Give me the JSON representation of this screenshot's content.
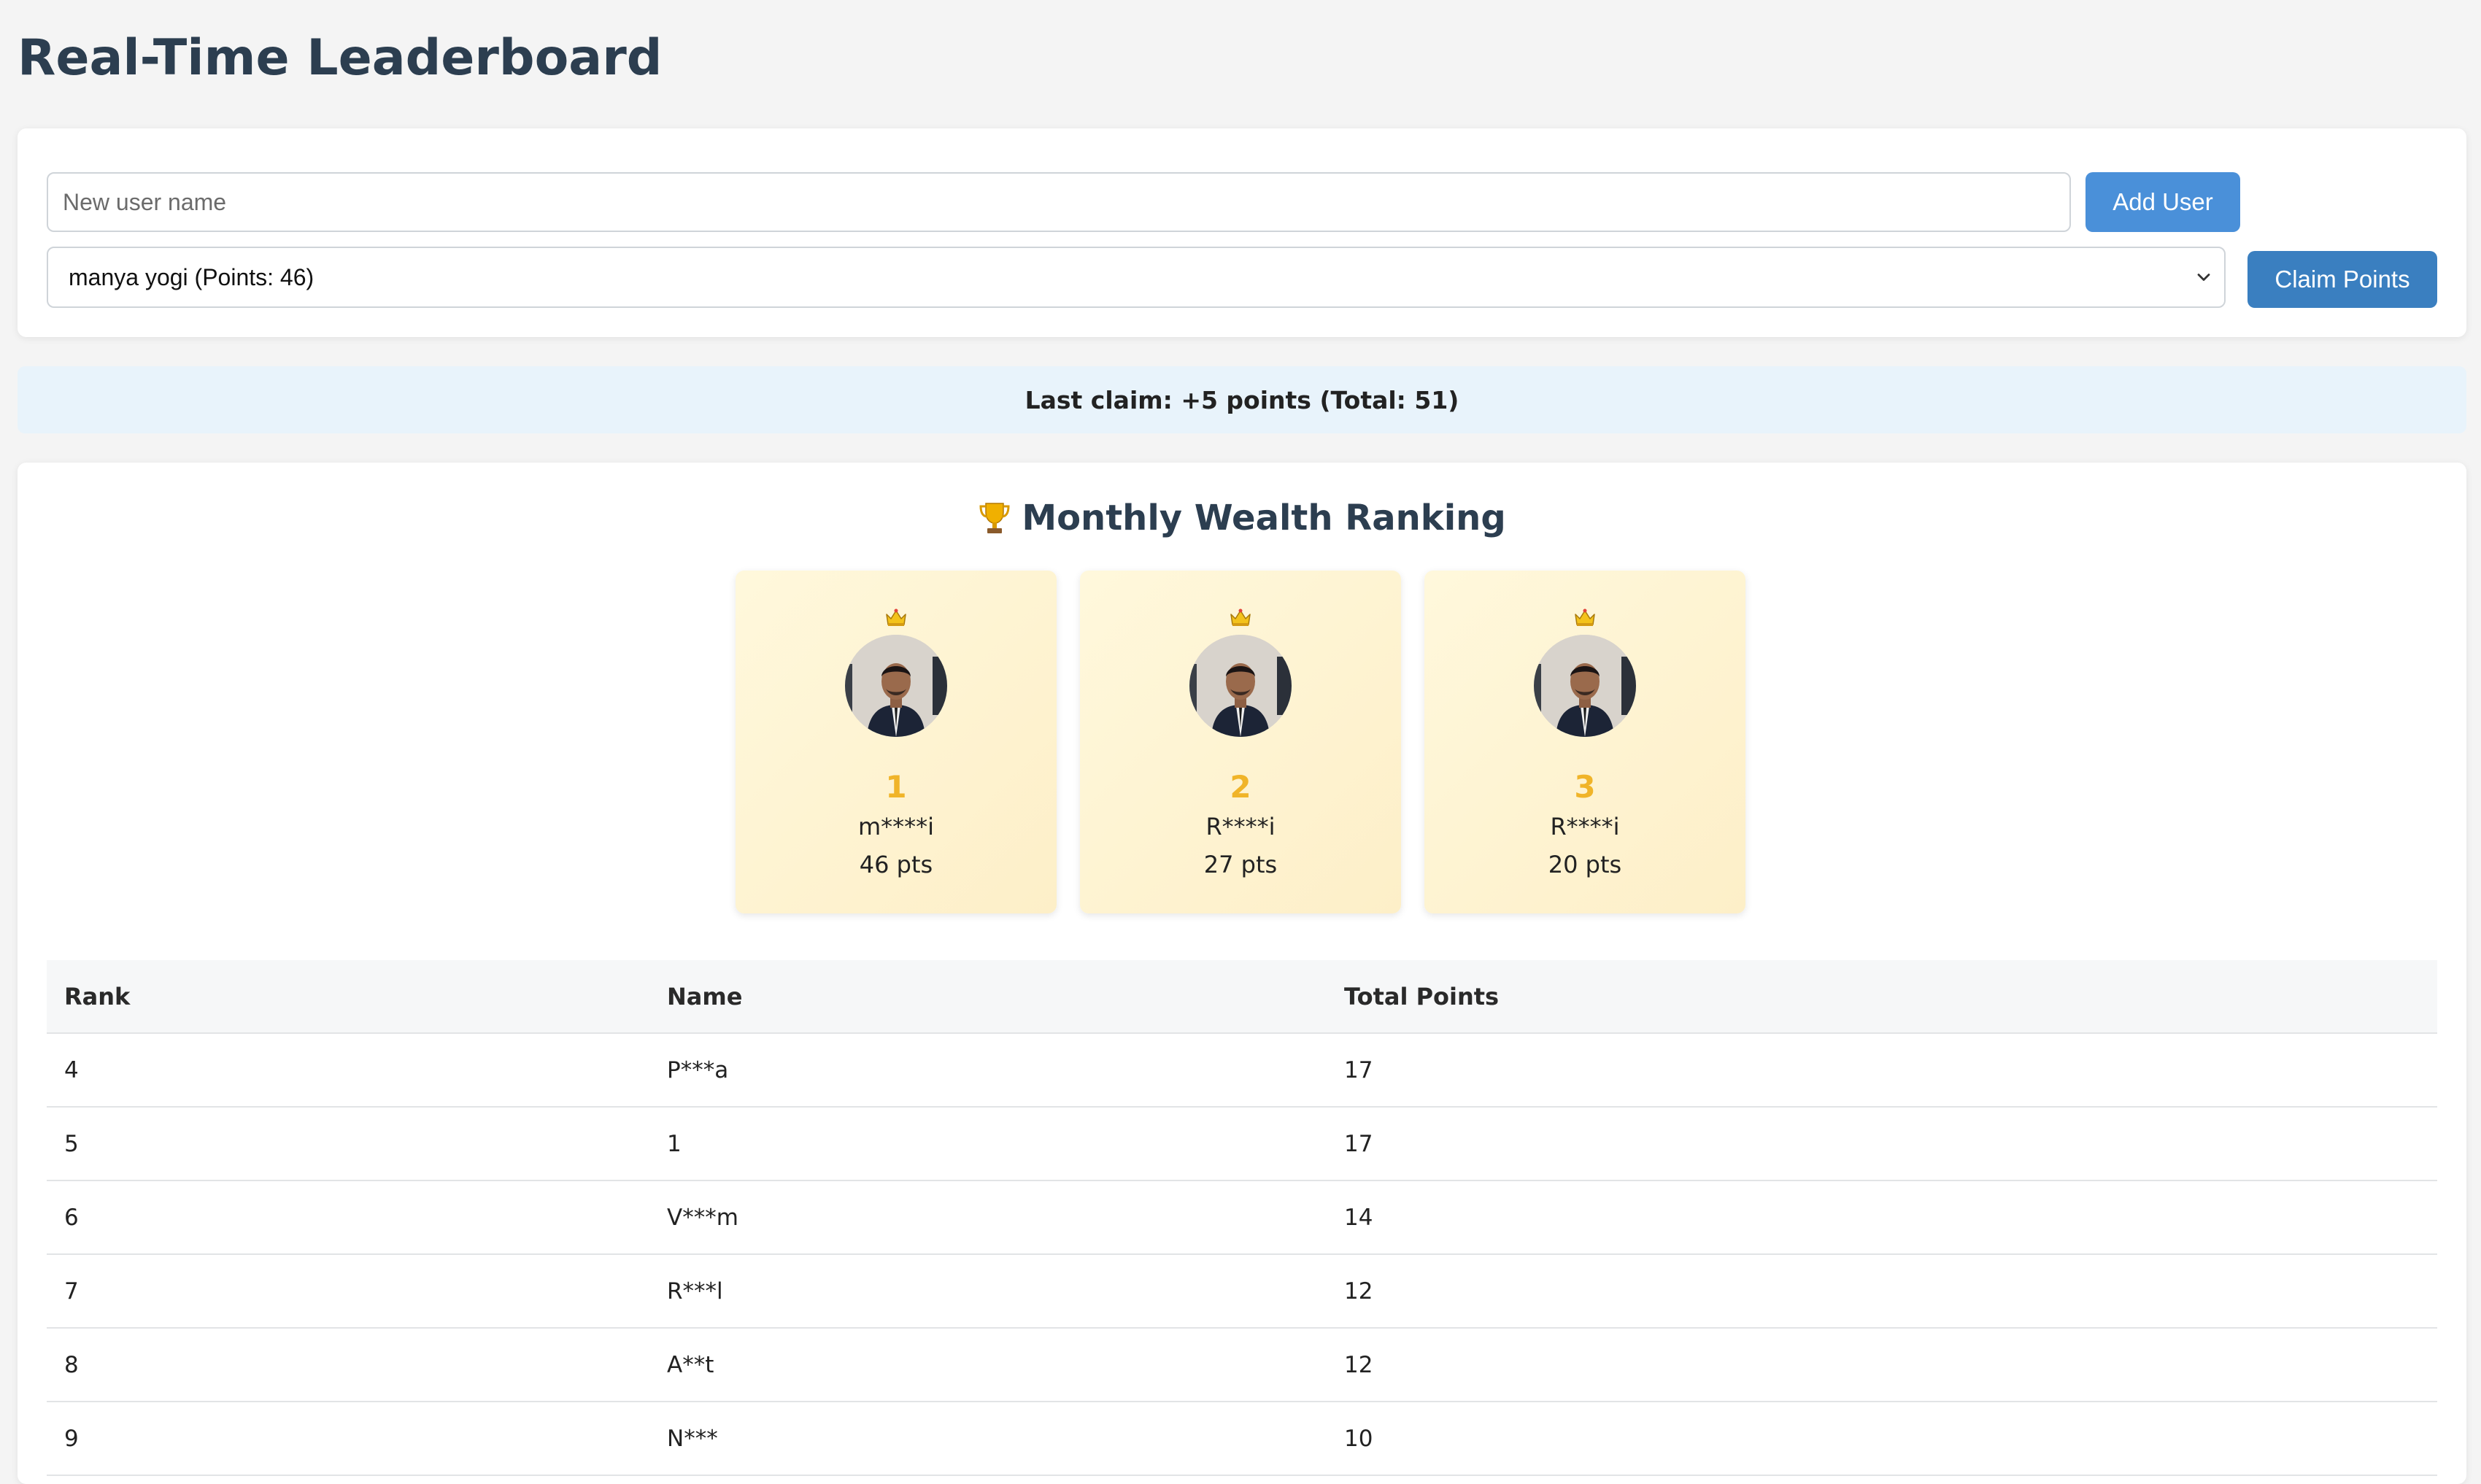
{
  "app": {
    "title": "Real-Time Leaderboard"
  },
  "controls": {
    "new_user_placeholder": "New user name",
    "add_user_label": "Add User",
    "selected_user": "manya yogi (Points: 46)",
    "claim_label": "Claim Points"
  },
  "status": {
    "text": "Last claim: +5 points (Total: 51)"
  },
  "ranking": {
    "title": "Monthly Wealth Ranking",
    "title_icon": "trophy-icon",
    "podium": [
      {
        "rank": "1",
        "name": "m****i",
        "points": "46 pts",
        "icon": "crown-icon"
      },
      {
        "rank": "2",
        "name": "R****i",
        "points": "27 pts",
        "icon": "crown-icon"
      },
      {
        "rank": "3",
        "name": "R****i",
        "points": "20 pts",
        "icon": "crown-icon"
      }
    ],
    "table": {
      "headers": [
        "Rank",
        "Name",
        "Total Points"
      ],
      "rows": [
        {
          "rank": "4",
          "name": "P***a",
          "points": "17"
        },
        {
          "rank": "5",
          "name": "1",
          "points": "17"
        },
        {
          "rank": "6",
          "name": "V***m",
          "points": "14"
        },
        {
          "rank": "7",
          "name": "R***l",
          "points": "12"
        },
        {
          "rank": "8",
          "name": "A**t",
          "points": "12"
        },
        {
          "rank": "9",
          "name": "N***",
          "points": "10"
        }
      ]
    }
  },
  "colors": {
    "title": "#2c3e50",
    "add_button": "#4a90d9",
    "claim_button": "#3a7fc0",
    "status_bg": "#e8f3fb",
    "podium_rank": "#f0b429",
    "podium_bg": "#fff8dc"
  }
}
